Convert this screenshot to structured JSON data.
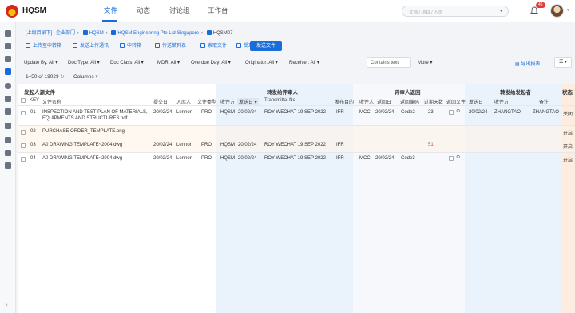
{
  "app": {
    "brand": "HQSM"
  },
  "nav": {
    "tabs": [
      "文件",
      "动态",
      "讨论组",
      "工作台"
    ],
    "active": "文件"
  },
  "search": {
    "placeholder": "文档 / 项目 / 人员",
    "caret": "▾"
  },
  "notifications": {
    "count": "46"
  },
  "breadcrumb": {
    "root": "[上级目录下]",
    "items": [
      "企业部门",
      "HQSM",
      "HQSM Engineering Pte Ltd-Singapore",
      "HQSM07"
    ]
  },
  "toolbar": {
    "buttons": [
      "上传至中转箱",
      "发送上传通讯",
      "中转箱",
      "传送单列表",
      "索取文件",
      "受理项目"
    ],
    "primary": "发送文件"
  },
  "filters": {
    "items": [
      "Update By: All",
      "Doc Type: All",
      "Doc Class: All",
      "MDR: All",
      "Overdue Day: All",
      "Originator: All",
      "Receiver: All"
    ],
    "contains_placeholder": "Contains text",
    "more": "More",
    "export": "导出报表"
  },
  "list": {
    "count": "1–50 of 19029",
    "columns": "Columns"
  },
  "groups": [
    "发起人源文件",
    "转发给评审人",
    "评审人返回",
    "转发给发起者",
    "状态"
  ],
  "columns": [
    "KEY",
    "文件名称",
    "提交日",
    "入库人",
    "文件类型",
    "收件方",
    "发送日",
    "Transmittal No",
    "发布目的",
    "收件人",
    "返回日",
    "返回编码",
    "过期天数",
    "返回文件",
    "发送日",
    "收件方",
    "备注"
  ],
  "rows": [
    {
      "key": "01",
      "name_line1": "INSPECTION AND TEST PLAN OF MATERIALS,",
      "name_line2": "EQUIPMENTS AND STRUCTURES.pdf",
      "submit": "20/02/24",
      "by": "Lennon",
      "type": "PRO",
      "recv": "HQSM",
      "send": "20/02/24",
      "trans": "ROY WECHAT 19 SEP 2022",
      "purpose": "IFR",
      "reviewer": "MCC",
      "return_date": "20/02/24",
      "code": "Code2",
      "overdue": "23",
      "fwd_date": "20/02/24",
      "fwd_to": "ZHANGTAO",
      "remark": "ZHANGTAO",
      "status": "关闭"
    },
    {
      "key": "02",
      "name_line1": "PURCHASE ORDER_TEMPLATE.png",
      "name_line2": "",
      "submit": "",
      "by": "",
      "type": "",
      "recv": "",
      "send": "",
      "trans": "",
      "purpose": "",
      "reviewer": "",
      "return_date": "",
      "code": "",
      "overdue": "",
      "fwd_date": "",
      "fwd_to": "",
      "remark": "",
      "status": "开启"
    },
    {
      "key": "03",
      "name_line1": "A0 DRAWING TEMPLATE~2004.dwg",
      "name_line2": "",
      "submit": "20/02/24",
      "by": "Lennon",
      "type": "PRO",
      "recv": "HQSM",
      "send": "20/02/24",
      "trans": "ROY WECHAT 19 SEP 2022",
      "purpose": "IFR",
      "reviewer": "",
      "return_date": "",
      "code": "",
      "overdue": "51",
      "fwd_date": "",
      "fwd_to": "",
      "remark": "",
      "status": "开启"
    },
    {
      "key": "04",
      "name_line1": "A0 DRAWING TEMPLATE~2004.dwg",
      "name_line2": "",
      "submit": "20/02/24",
      "by": "Lennon",
      "type": "PRO",
      "recv": "HQSM",
      "send": "20/02/24",
      "trans": "ROY WECHAT 19 SEP 2022",
      "purpose": "IFR",
      "reviewer": "MCC",
      "return_date": "20/02/24",
      "code": "Code3",
      "overdue": "",
      "fwd_date": "",
      "fwd_to": "",
      "remark": "",
      "status": "开启"
    }
  ],
  "icons": [
    "logo-icon",
    "bell-icon",
    "avatar",
    "sidebar-folder-icon",
    "clip-icon"
  ],
  "colors": {
    "accent": "#1a6dd8",
    "overdue": "#e53935"
  }
}
